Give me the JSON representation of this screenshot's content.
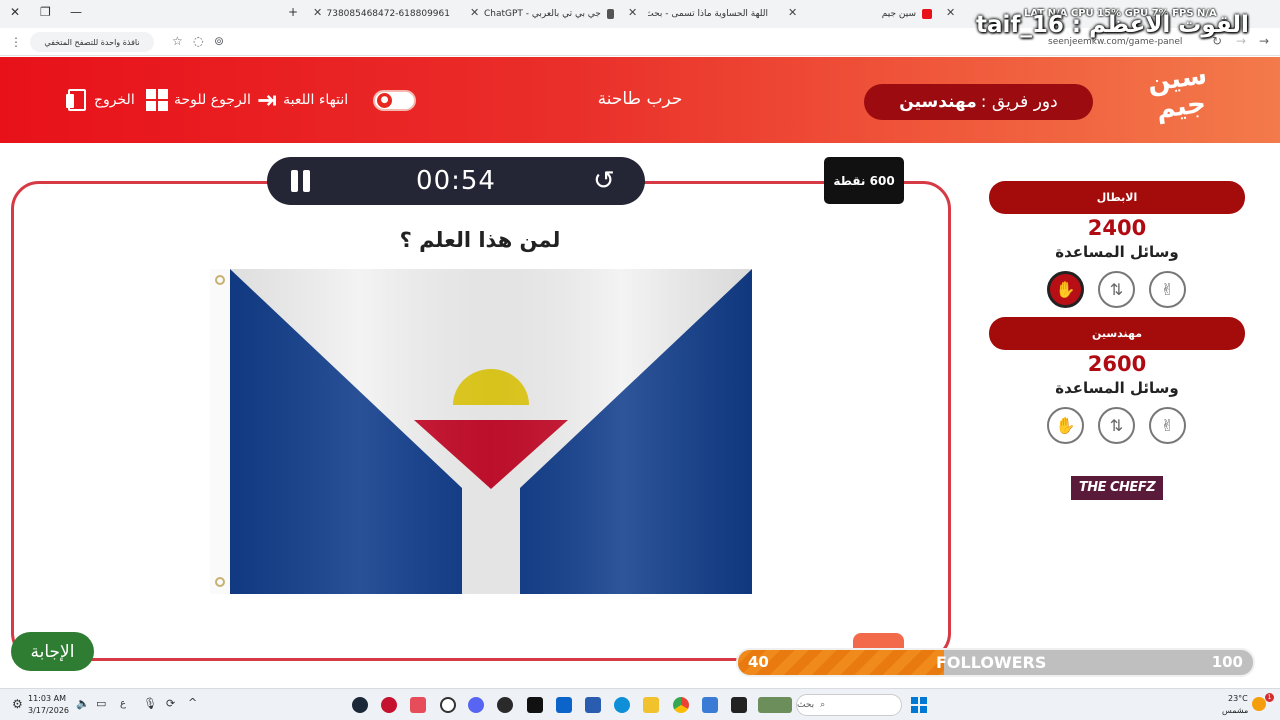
{
  "browser": {
    "tabs": [
      {
        "title": "سين جيم"
      },
      {
        "title": "اللهة الحساوية ماذا تسمى - بحث"
      },
      {
        "title": "جي بي تي بالعربي - ChatGPT"
      },
      {
        "title": "1738085468472-618809961.jpg"
      }
    ],
    "url": "seenjeemkw.com/game-panel",
    "incognito_label": "نافذة واحدة للتصفح المتخفي"
  },
  "overlay": {
    "stats": "LAT N/A    CPU 15%    GPU 7%    FPS N/A",
    "streamer": "taif_16 : القوت الاعظم"
  },
  "header": {
    "logo": "سين جيم",
    "turn_prefix": "دور فريق :",
    "turn_team": "مهندسين",
    "category": "حرب طاحنة",
    "end_game": "انتهاء اللعبة",
    "back_to_board": "الرجوع للوحة",
    "exit": "الخروج"
  },
  "game": {
    "timer": "00:54",
    "points": "600 نقطة",
    "question": "لمن هذا العلم ؟",
    "answer_button": "الإجابة"
  },
  "teams": [
    {
      "name": "الابطال",
      "score": "2400",
      "aids_label": "وسائل المساعدة"
    },
    {
      "name": "مهندسين",
      "score": "2600",
      "aids_label": "وسائل المساعدة"
    }
  ],
  "sponsor": "THE CHEFZ",
  "followers": {
    "current": "40",
    "label": "FOLLOWERS",
    "goal": "100",
    "progress": 0.4
  },
  "taskbar": {
    "time": "11:03 AM",
    "date": "3/17/2026",
    "weather_temp": "23°C",
    "weather_text": "مشمس",
    "search_placeholder": "بحث",
    "lang": "ع"
  },
  "colors": {
    "header_red": "#e8111a",
    "board_border": "#d63a44",
    "team_header": "#a40b0b",
    "answer_green": "#2e7d32"
  }
}
